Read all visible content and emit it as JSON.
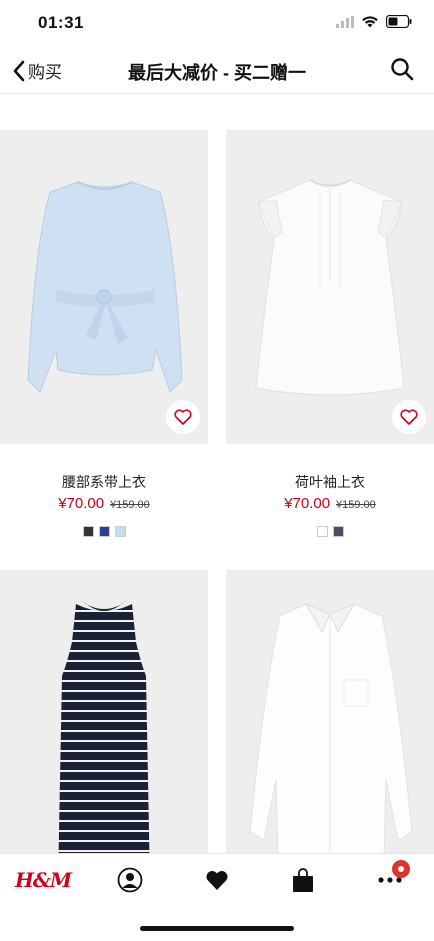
{
  "status": {
    "time": "01:31"
  },
  "nav": {
    "back_label": "购买",
    "title": "最后大减价 - 买二赠一"
  },
  "products": [
    {
      "name": "腰部系带上衣",
      "sale_price": "¥70.00",
      "original_price": "¥159.00",
      "swatches": [
        "#333333",
        "#2a3f8f",
        "#c8dcef"
      ]
    },
    {
      "name": "荷叶袖上衣",
      "sale_price": "¥70.00",
      "original_price": "¥159.00",
      "swatches": [
        "#ffffff",
        "#4a4e5e"
      ]
    },
    {
      "name": "",
      "sale_price": "",
      "original_price": "",
      "swatches": []
    },
    {
      "name": "",
      "sale_price": "",
      "original_price": "",
      "swatches": []
    }
  ],
  "tabbar": {
    "home_logo": "H&M",
    "tabs": [
      "home-logo",
      "account-icon",
      "favorites-icon",
      "bag-icon",
      "more-icon"
    ]
  },
  "colors": {
    "accent": "#d0021b",
    "badge": "#e2332a",
    "image_bg": "#eeeeee"
  }
}
